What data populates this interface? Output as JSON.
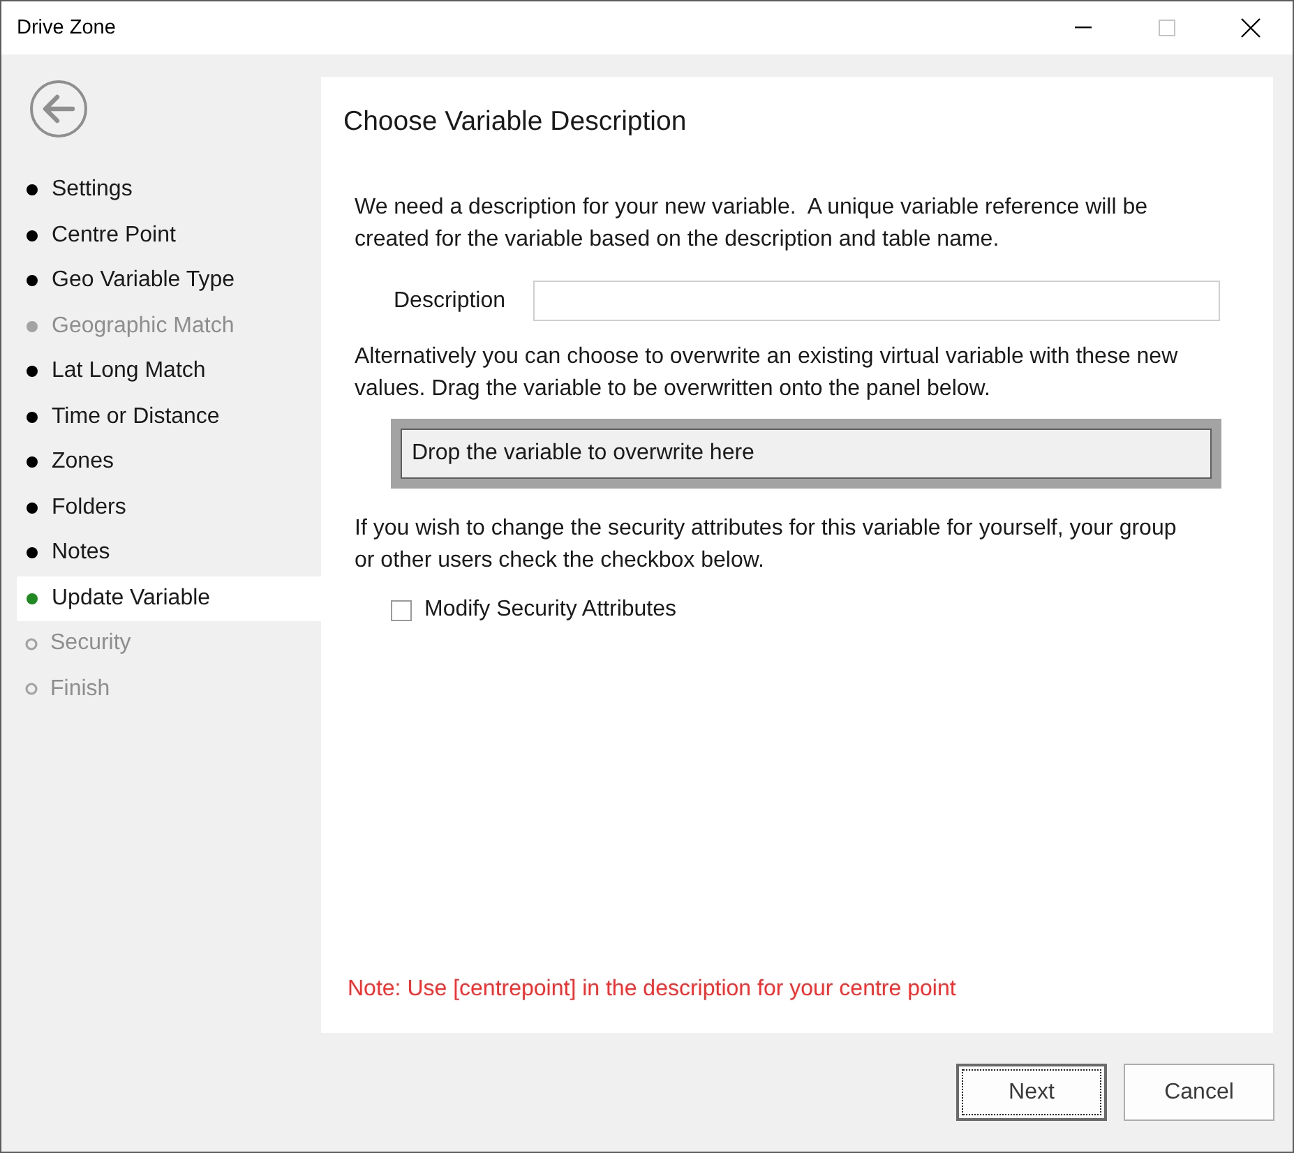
{
  "window": {
    "title": "Drive Zone",
    "maximize_disabled": true
  },
  "sidebar": {
    "steps": [
      {
        "label": "Settings",
        "kind": "done",
        "disabled": false,
        "selected": false
      },
      {
        "label": "Centre Point",
        "kind": "done",
        "disabled": false,
        "selected": false
      },
      {
        "label": "Geo Variable Type",
        "kind": "done",
        "disabled": false,
        "selected": false
      },
      {
        "label": "Geographic Match",
        "kind": "done",
        "disabled": true,
        "selected": false
      },
      {
        "label": "Lat Long Match",
        "kind": "done",
        "disabled": false,
        "selected": false
      },
      {
        "label": "Time or Distance",
        "kind": "done",
        "disabled": false,
        "selected": false
      },
      {
        "label": "Zones",
        "kind": "done",
        "disabled": false,
        "selected": false
      },
      {
        "label": "Folders",
        "kind": "done",
        "disabled": false,
        "selected": false
      },
      {
        "label": "Notes",
        "kind": "done",
        "disabled": false,
        "selected": false
      },
      {
        "label": "Update Variable",
        "kind": "done",
        "disabled": false,
        "selected": true
      },
      {
        "label": "Security",
        "kind": "pending",
        "disabled": true,
        "selected": false
      },
      {
        "label": "Finish",
        "kind": "pending",
        "disabled": true,
        "selected": false
      }
    ]
  },
  "page": {
    "heading": "Choose Variable Description",
    "intro": "We need a description for your new variable.  A unique variable reference will be created for the variable based on the description and table name.",
    "description_label": "Description",
    "overwrite_text": "Alternatively you can choose to overwrite an existing virtual variable with these new values. Drag the variable to be overwritten onto the panel below.",
    "drop_zone": "Drop the variable to overwrite here",
    "security_text": "If you wish to change the security attributes for this variable for yourself, your group or other users check the checkbox below.",
    "checkbox": {
      "label": "Modify Security Attributes",
      "checked": false
    },
    "note": "Note: Use [centrepoint] in the description for your centre point"
  },
  "buttons": [
    {
      "label": "Next",
      "default": true
    },
    {
      "label": "Cancel",
      "default": false
    }
  ]
}
